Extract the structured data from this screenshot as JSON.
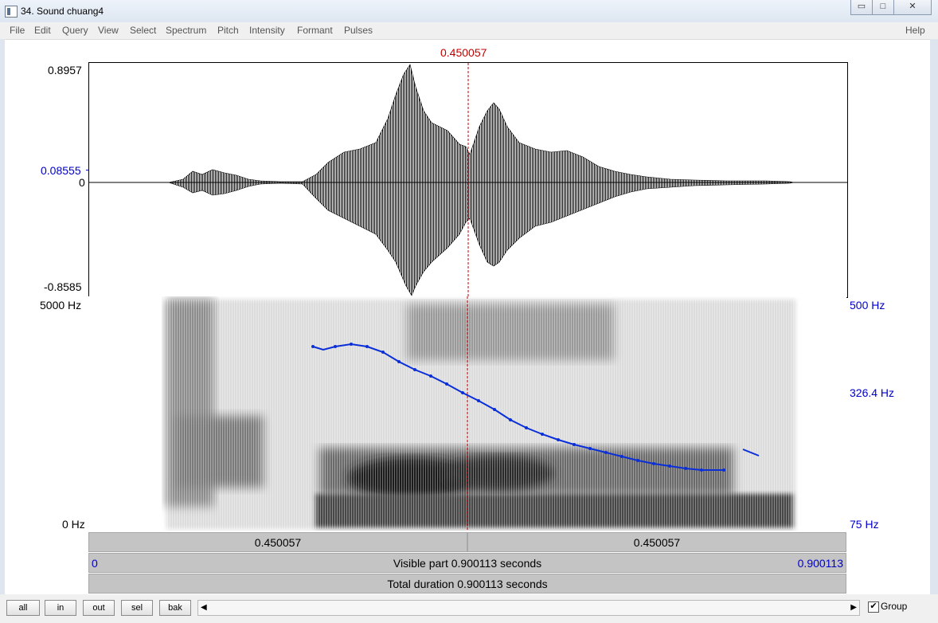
{
  "window": {
    "title": "34. Sound chuang4",
    "controls": {
      "minimize": "▭",
      "maximize": "□",
      "close": "✕"
    }
  },
  "menu": {
    "items": [
      "File",
      "Edit",
      "Query",
      "View",
      "Select",
      "Spectrum",
      "Pitch",
      "Intensity",
      "Formant",
      "Pulses"
    ],
    "help": "Help"
  },
  "cursor": {
    "time": "0.450057"
  },
  "waveform": {
    "max": "0.8957",
    "zero": "0",
    "min": "-0.8585",
    "cursor_amplitude": "0.08555"
  },
  "spectrogram": {
    "freq_top": "5000 Hz",
    "freq_bottom": "0 Hz",
    "pitch_top": "500 Hz",
    "pitch_mid": "326.4 Hz",
    "pitch_bottom": "75 Hz"
  },
  "time_bars": {
    "left_segment": "0.450057",
    "right_segment": "0.450057",
    "visible_start": "0",
    "visible_label": "Visible part 0.900113 seconds",
    "visible_end": "0.900113",
    "total_label": "Total duration 0.900113 seconds"
  },
  "buttons": {
    "all": "all",
    "in": "in",
    "out": "out",
    "sel": "sel",
    "bak": "bak"
  },
  "group": {
    "label": "Group",
    "checked": true
  },
  "colors": {
    "pitch": "#0a2ed8",
    "cursor": "#c00000",
    "axis_blue": "#0000c8"
  }
}
